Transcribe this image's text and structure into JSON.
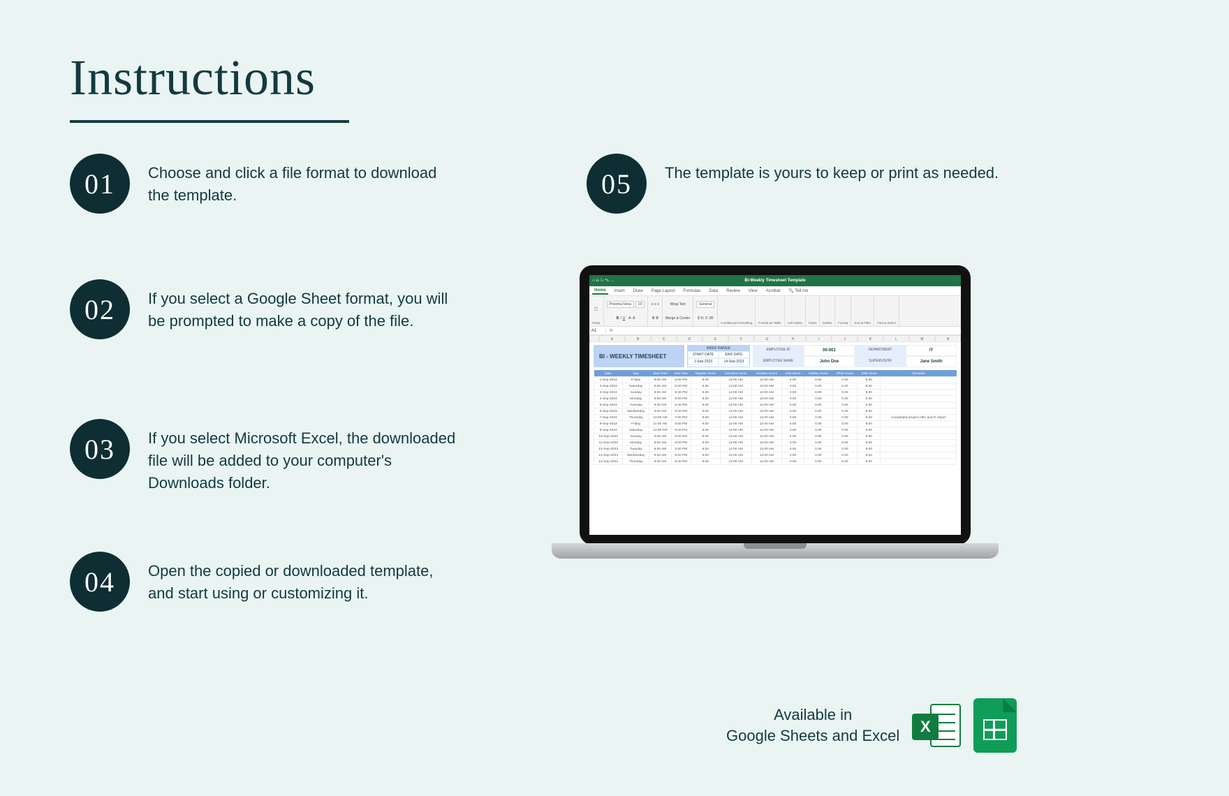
{
  "title": "Instructions",
  "steps": [
    {
      "num": "01",
      "text": "Choose and click a file format to download the template."
    },
    {
      "num": "02",
      "text": "If you select a Google Sheet format, you will be prompted to make a copy of the file."
    },
    {
      "num": "03",
      "text": "If you select Microsoft Excel, the downloaded file will be added to your computer's Downloads folder."
    },
    {
      "num": "04",
      "text": "Open the copied or downloaded template, and start using or customizing it."
    },
    {
      "num": "05",
      "text": "The template is yours to keep or print as needed."
    }
  ],
  "available": {
    "line1": "Available in",
    "line2": "Google Sheets and Excel"
  },
  "excel_badge": "X",
  "laptop": {
    "window_title": "Bi-Weekly Timesheet Template",
    "tabs": [
      "Home",
      "Insert",
      "Draw",
      "Page Layout",
      "Formulas",
      "Data",
      "Review",
      "View",
      "Acrobat",
      "Tell me"
    ],
    "ribbon": {
      "paste": "Paste",
      "font_name": "Proxima Nova",
      "font_size": "10",
      "wrap": "Wrap Text",
      "merge": "Merge & Center",
      "number_format": "General",
      "cond": "Conditional Formatting",
      "fmt_table": "Format as Table",
      "styles": "Cell Styles",
      "insert": "Insert",
      "delete": "Delete",
      "format": "Format",
      "sort": "Sort & Filter",
      "find": "Find & Select"
    },
    "cell_ref": "A1",
    "fx": "fx",
    "col_letters": [
      "A",
      "B",
      "C",
      "D",
      "E",
      "F",
      "G",
      "H",
      "I",
      "J",
      "K",
      "L",
      "M",
      "N"
    ],
    "timesheet": {
      "title": "BI - WEEKLY TIMESHEET",
      "range_header": "WEEK RANGE",
      "start_label": "START DATE",
      "end_label": "END DATE",
      "start": "1-Sep-2023",
      "end": "14-Sep-2023",
      "emp_id_label": "EMPLOYEE ID",
      "emp_id": "00-001",
      "dept_label": "DEPARTMENT",
      "dept": "IT",
      "emp_name_label": "EMPLOYEE NAME",
      "emp_name": "John Doe",
      "sup_label": "SUPERVISOR",
      "sup": "Jane Smith",
      "columns": [
        "Date",
        "Day",
        "Start Time",
        "End Time",
        "Regular Hours",
        "Overtime Hours",
        "Vacation Hours",
        "Sick Hours",
        "Holiday Hours",
        "Other Hours",
        "Total Hours",
        "Remarks"
      ],
      "rows": [
        [
          "1-Sep-2023",
          "Friday",
          "9:00 AM",
          "6:00 PM",
          "9.00",
          "12:00 AM",
          "12:00 AM",
          "0.00",
          "0.00",
          "0.00",
          "9.00",
          ""
        ],
        [
          "2-Sep-2023",
          "Saturday",
          "9:00 AM",
          "6:00 PM",
          "9.00",
          "12:00 AM",
          "12:00 AM",
          "0.00",
          "0.00",
          "0.00",
          "9.00",
          ""
        ],
        [
          "3-Sep-2023",
          "Sunday",
          "9:00 AM",
          "5:30 PM",
          "9.00",
          "12:00 AM",
          "12:00 AM",
          "0.00",
          "0.00",
          "0.00",
          "9.00",
          ""
        ],
        [
          "4-Sep-2023",
          "Monday",
          "9:00 AM",
          "6:00 PM",
          "9.00",
          "12:00 AM",
          "12:00 AM",
          "0.00",
          "0.00",
          "0.00",
          "9.00",
          ""
        ],
        [
          "5-Sep-2023",
          "Tuesday",
          "9:30 AM",
          "5:30 PM",
          "9.00",
          "12:00 AM",
          "12:00 AM",
          "0.00",
          "0.00",
          "0.00",
          "9.00",
          ""
        ],
        [
          "6-Sep-2023",
          "Wednesday",
          "9:00 AM",
          "6:00 PM",
          "9.00",
          "12:00 AM",
          "12:00 AM",
          "0.00",
          "0.00",
          "0.00",
          "9.00",
          ""
        ],
        [
          "7-Sep-2023",
          "Thursday",
          "10:00 AM",
          "7:00 PM",
          "9.00",
          "12:00 AM",
          "12:00 AM",
          "0.00",
          "0.00",
          "0.00",
          "9.00",
          "Completed project ABC and D report"
        ],
        [
          "8-Sep-2023",
          "Friday",
          "11:00 AM",
          "8:00 PM",
          "9.00",
          "12:00 AM",
          "12:00 AM",
          "0.00",
          "0.00",
          "0.00",
          "9.00",
          ""
        ],
        [
          "9-Sep-2023",
          "Saturday",
          "12:00 PM",
          "9:00 PM",
          "9.00",
          "12:00 AM",
          "12:00 AM",
          "0.00",
          "0.00",
          "0.00",
          "9.00",
          ""
        ],
        [
          "10-Sep-2023",
          "Sunday",
          "9:00 AM",
          "6:00 PM",
          "9.00",
          "12:00 AM",
          "12:00 AM",
          "0.00",
          "0.00",
          "0.00",
          "9.00",
          ""
        ],
        [
          "11-Sep-2023",
          "Monday",
          "9:00 AM",
          "6:00 PM",
          "9.00",
          "12:00 AM",
          "12:00 AM",
          "0.00",
          "0.00",
          "0.00",
          "9.00",
          ""
        ],
        [
          "12-Sep-2023",
          "Tuesday",
          "9:00 AM",
          "5:30 PM",
          "8.00",
          "12:00 AM",
          "12:00 AM",
          "0.00",
          "0.00",
          "0.00",
          "9.00",
          ""
        ],
        [
          "13-Sep-2023",
          "Wednesday",
          "9:00 AM",
          "6:00 PM",
          "9.00",
          "12:00 AM",
          "12:00 AM",
          "0.00",
          "0.00",
          "0.00",
          "9.00",
          ""
        ],
        [
          "14-Sep-2023",
          "Thursday",
          "9:30 AM",
          "5:30 PM",
          "9.00",
          "12:00 AM",
          "12:00 AM",
          "0.00",
          "0.00",
          "0.00",
          "9.00",
          ""
        ]
      ]
    }
  }
}
